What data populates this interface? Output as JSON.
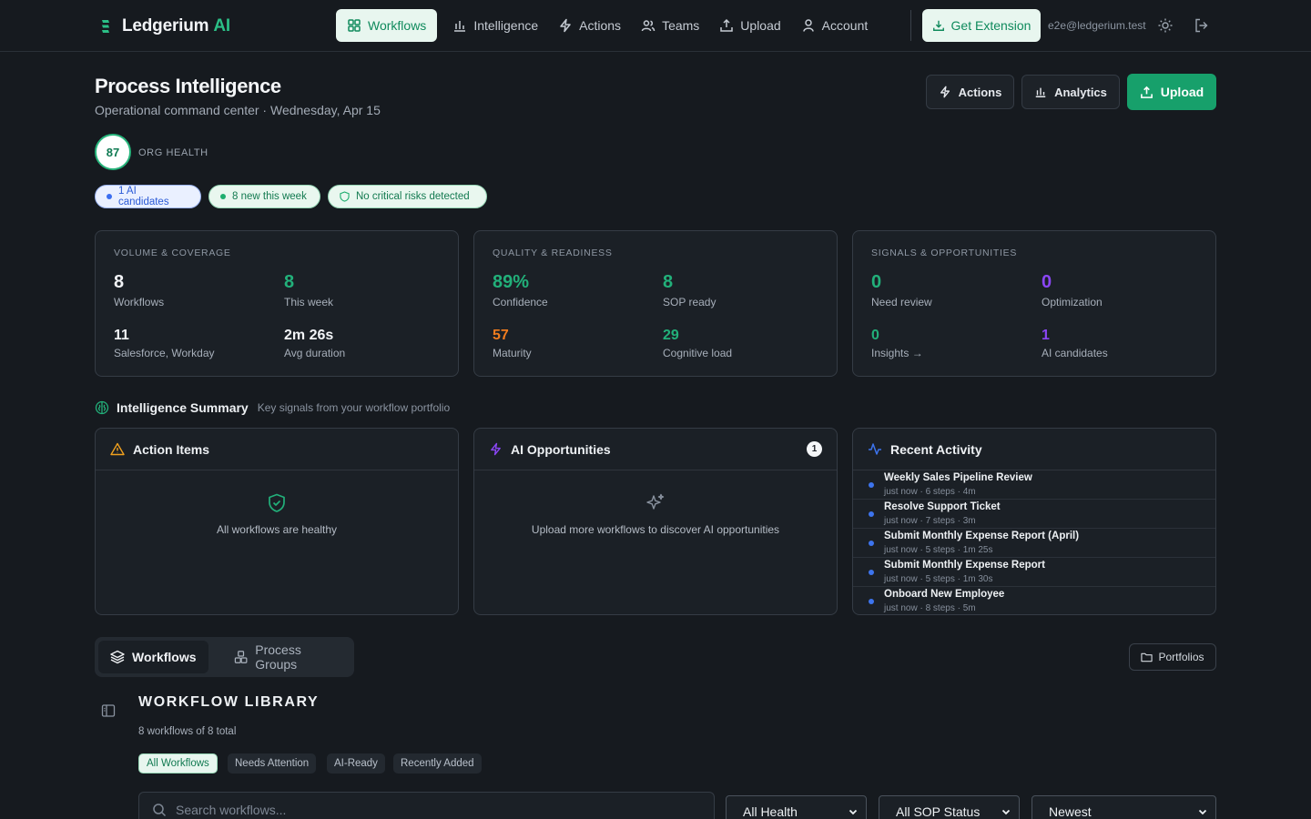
{
  "brand": {
    "name": "Ledgerium",
    "suffix": "AI"
  },
  "nav": {
    "items": [
      {
        "label": "Workflows",
        "icon": "grid-icon",
        "active": true
      },
      {
        "label": "Intelligence",
        "icon": "bar-chart-icon"
      },
      {
        "label": "Actions",
        "icon": "lightning-icon"
      },
      {
        "label": "Teams",
        "icon": "users-icon"
      },
      {
        "label": "Upload",
        "icon": "upload-icon"
      },
      {
        "label": "Account",
        "icon": "user-icon"
      }
    ],
    "get_extension": "Get Extension",
    "email": "e2e@ledgerium.test"
  },
  "header": {
    "title": "Process Intelligence",
    "subtitle": "Operational command center · Wednesday, Apr 15",
    "buttons": {
      "actions": "Actions",
      "analytics": "Analytics",
      "upload": "Upload"
    },
    "health_score": "87",
    "health_label": "ORG HEALTH",
    "pills": [
      "1 AI candidates",
      "8 new this week",
      "No critical risks detected"
    ]
  },
  "cards": {
    "volume": {
      "title": "VOLUME & COVERAGE",
      "m1": {
        "value": "8",
        "label": "Workflows"
      },
      "m2": {
        "value": "8",
        "label": "This week"
      },
      "m3": {
        "value": "11",
        "label": "Salesforce, Workday"
      },
      "m4": {
        "value": "2m 26s",
        "label": "Avg duration"
      }
    },
    "quality": {
      "title": "QUALITY & READINESS",
      "m1": {
        "value": "89%",
        "label": "Confidence"
      },
      "m2": {
        "value": "8",
        "label": "SOP ready"
      },
      "m3": {
        "value": "57",
        "label": "Maturity"
      },
      "m4": {
        "value": "29",
        "label": "Cognitive load"
      }
    },
    "signals": {
      "title": "SIGNALS & OPPORTUNITIES",
      "m1": {
        "value": "0",
        "label": "Need review"
      },
      "m2": {
        "value": "0",
        "label": "Optimization"
      },
      "m3": {
        "value": "0",
        "label": "Insights →"
      },
      "m4": {
        "value": "1",
        "label": "AI candidates"
      }
    }
  },
  "summary": {
    "title": "Intelligence Summary",
    "subtitle": "Key signals from your workflow portfolio",
    "action_items": {
      "title": "Action Items",
      "empty": "All workflows are healthy"
    },
    "ai_opps": {
      "title": "AI Opportunities",
      "badge": "1",
      "empty": "Upload more workflows to discover AI opportunities"
    },
    "recent": {
      "title": "Recent Activity",
      "items": [
        {
          "name": "Weekly Sales Pipeline Review",
          "meta": "just now · 6 steps · 4m"
        },
        {
          "name": "Resolve Support Ticket",
          "meta": "just now · 7 steps · 3m"
        },
        {
          "name": "Submit Monthly Expense Report (April)",
          "meta": "just now · 5 steps · 1m 25s"
        },
        {
          "name": "Submit Monthly Expense Report",
          "meta": "just now · 5 steps · 1m 30s"
        },
        {
          "name": "Onboard New Employee",
          "meta": "just now · 8 steps · 5m"
        }
      ]
    }
  },
  "library": {
    "tabs": [
      "Workflows",
      "Process Groups"
    ],
    "portfolios": "Portfolios",
    "title": "WORKFLOW LIBRARY",
    "count": "8 workflows of 8 total",
    "filters": [
      "All Workflows",
      "Needs Attention",
      "AI-Ready",
      "Recently Added"
    ],
    "search_placeholder": "Search workflows...",
    "selects": [
      "All Health",
      "All SOP Status",
      "Newest"
    ]
  },
  "colors": {
    "accent": "#17a06b",
    "background": "#161a1f",
    "card": "#1b2026",
    "info": "#3d74ee",
    "warning": "#f0a01e",
    "ai": "#8b46f5"
  }
}
